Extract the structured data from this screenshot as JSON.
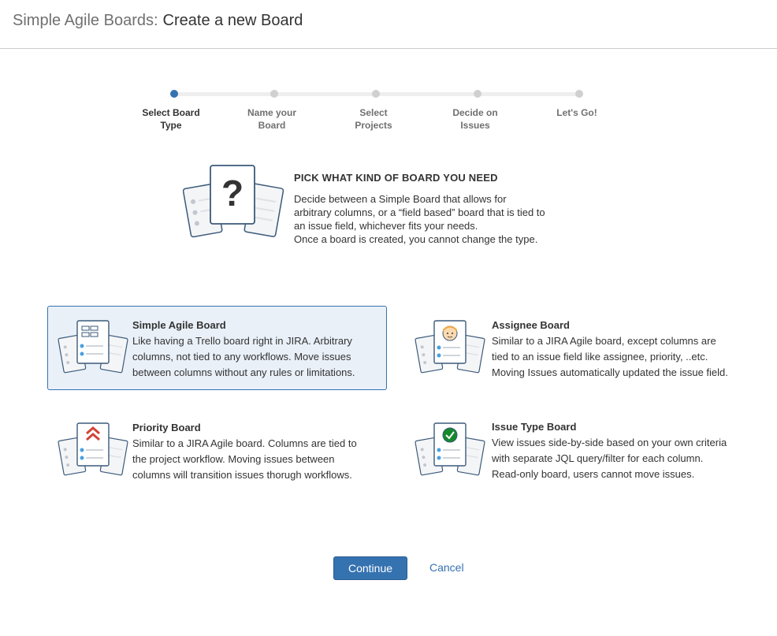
{
  "header": {
    "app_name": "Simple Agile Boards:",
    "page_title": "Create a new Board"
  },
  "steps": [
    {
      "line1": "Select Board",
      "line2": "Type",
      "active": true
    },
    {
      "line1": "Name your",
      "line2": "Board",
      "active": false
    },
    {
      "line1": "Select",
      "line2": "Projects",
      "active": false
    },
    {
      "line1": "Decide on",
      "line2": "Issues",
      "active": false
    },
    {
      "line1": "Let's Go!",
      "line2": "",
      "active": false
    }
  ],
  "intro": {
    "heading": "PICK WHAT KIND OF BOARD YOU NEED",
    "lines": [
      "Decide between a Simple Board that allows for",
      "arbitrary columns, or a “field based” board that is tied to",
      "an issue field, whichever fits your needs.",
      "Once a board is created, you cannot change the type."
    ]
  },
  "options": [
    {
      "title": "Simple Agile Board",
      "lines": [
        "Like having a Trello board right in JIRA. Arbitrary",
        "columns, not tied to any workflows. Move issues",
        "between columns without any rules or limitations."
      ],
      "icon": "columns-board-icon",
      "selected": true
    },
    {
      "title": "Assignee Board",
      "lines": [
        "Similar to a JIRA Agile board, except columns are",
        "tied to an issue field like assignee, priority, ..etc.",
        "Moving Issues automatically updated the issue field."
      ],
      "icon": "person-board-icon",
      "selected": false
    },
    {
      "title": "Priority Board",
      "lines": [
        "Similar to a JIRA Agile board. Columns are tied to",
        "the project workflow. Moving issues between",
        "columns will transition issues thorugh workflows."
      ],
      "icon": "priority-board-icon",
      "selected": false
    },
    {
      "title": "Issue Type Board",
      "lines": [
        "View issues side-by-side based on your own criteria",
        "with separate JQL query/filter for each column.",
        "Read-only board, users cannot move issues."
      ],
      "icon": "checkmark-board-icon",
      "selected": false
    }
  ],
  "actions": {
    "continue_label": "Continue",
    "cancel_label": "Cancel"
  },
  "colors": {
    "accent": "#3572b0",
    "selected_bg": "#e9f0f8",
    "priority_red": "#d04437",
    "check_green": "#14892c"
  }
}
